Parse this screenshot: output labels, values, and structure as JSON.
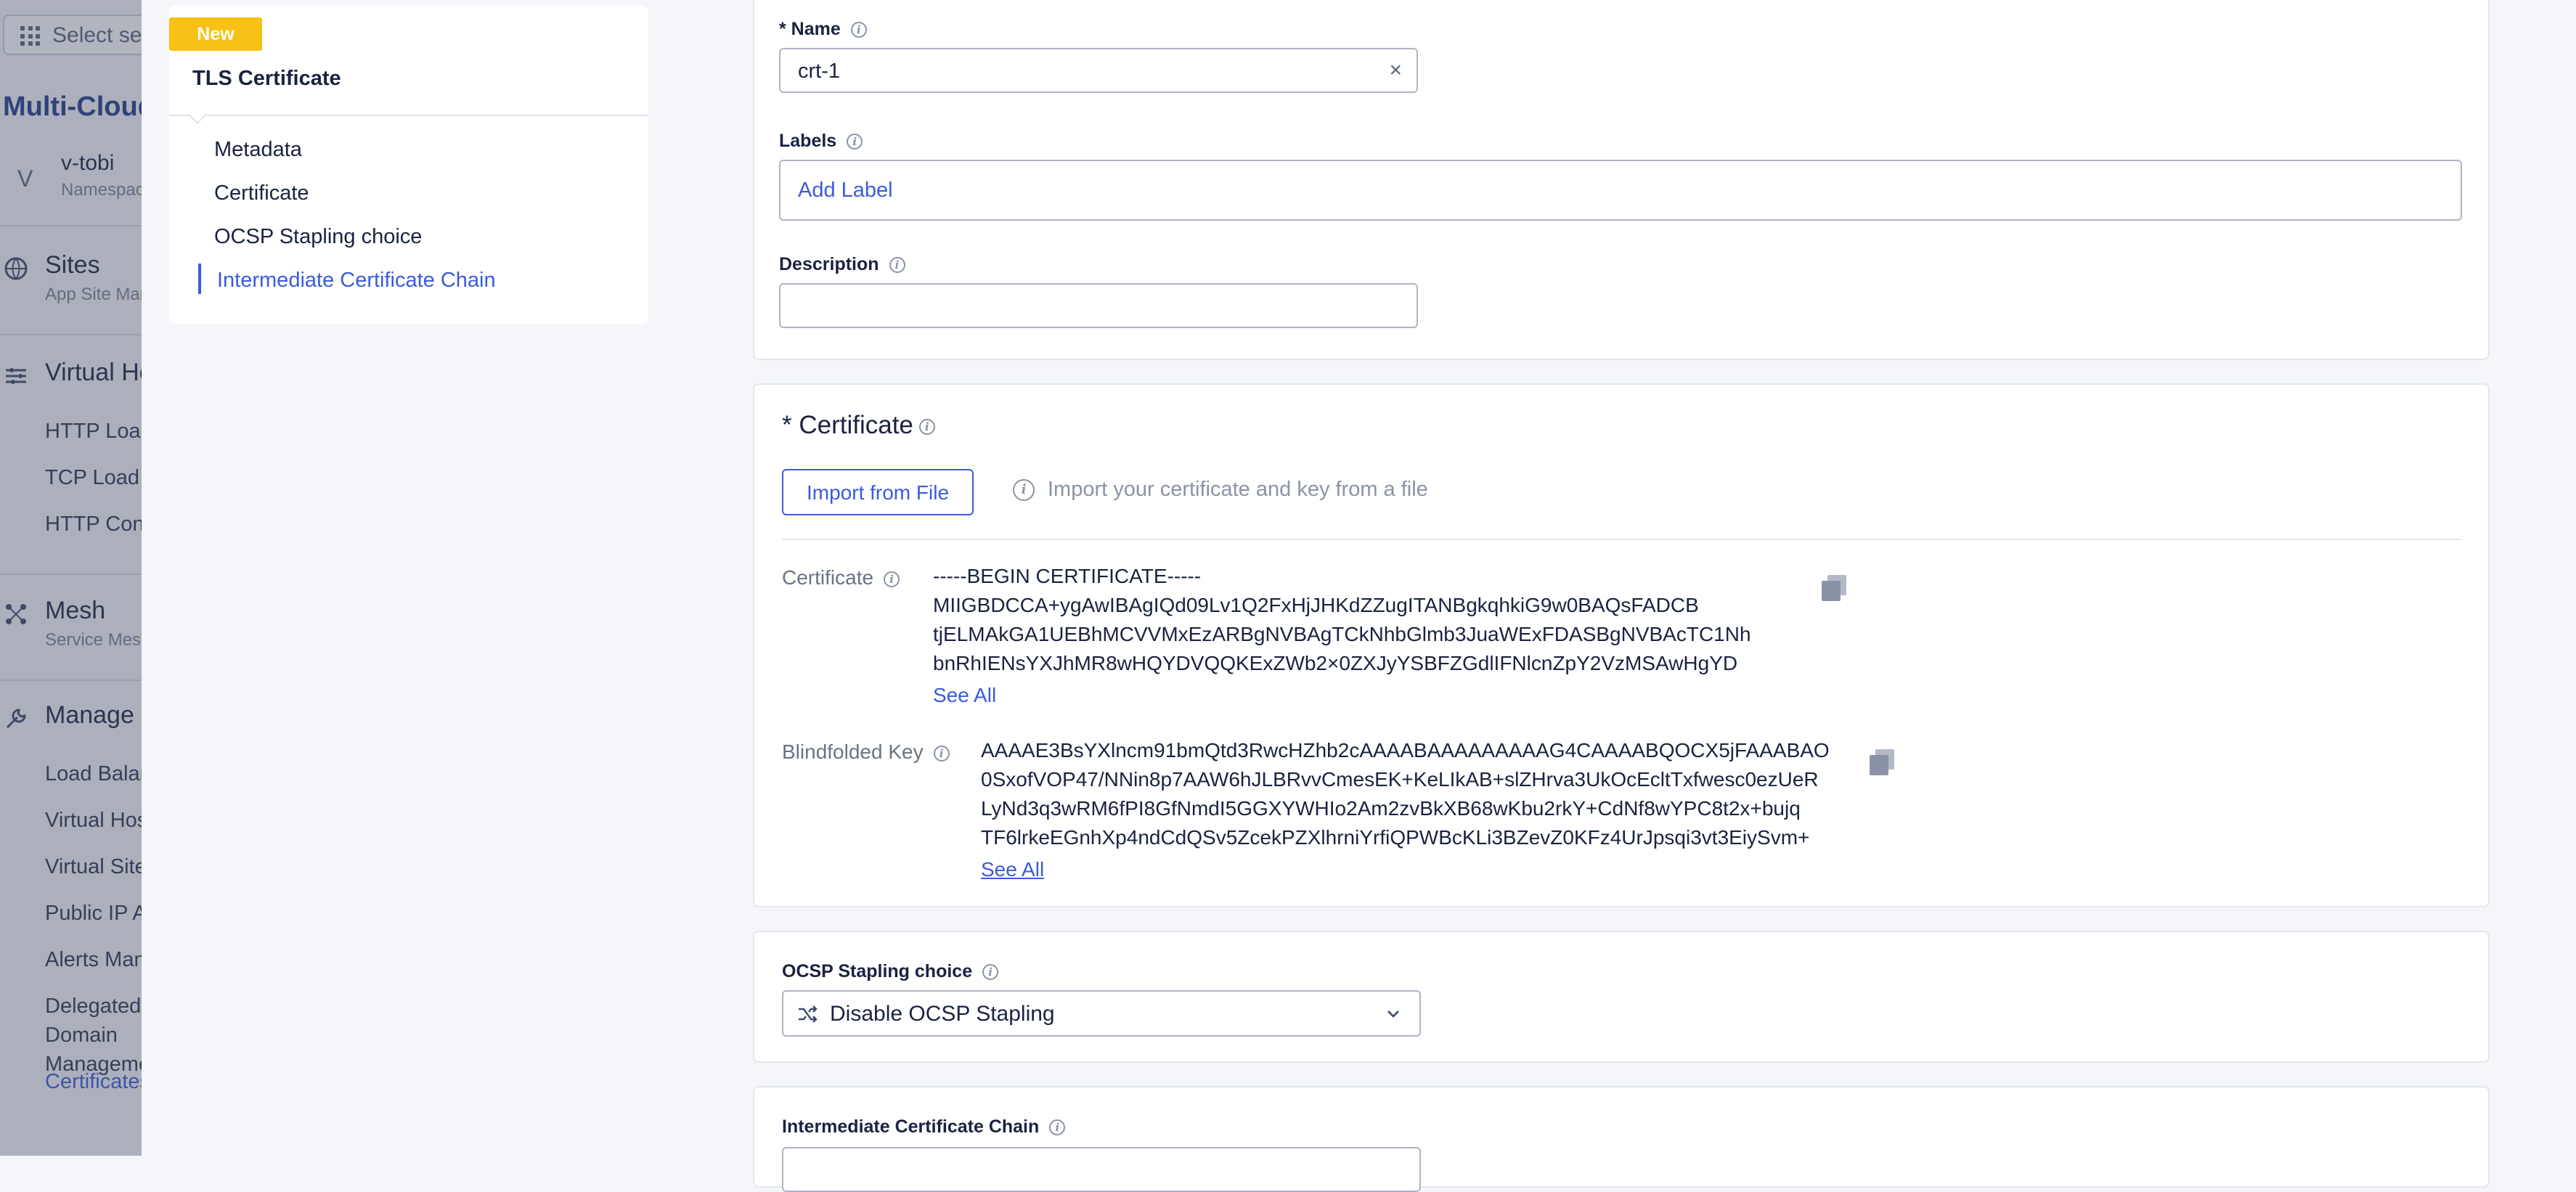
{
  "app_sidebar": {
    "select_service": "Select service",
    "product_title": "Multi-Cloud App Connect",
    "namespace": {
      "avatar": "V",
      "name": "v-tobi",
      "label": "Namespace"
    },
    "sections": [
      {
        "title": "Sites",
        "subtitle": "App Site Management"
      },
      {
        "title": "Virtual Hosts",
        "items": [
          "HTTP Load Balancers",
          "TCP Load Balancers",
          "HTTP Connect Proxies"
        ]
      },
      {
        "title": "Mesh",
        "subtitle": "Service Mesh"
      },
      {
        "title": "Manage",
        "items": [
          "Load Balancers",
          "Virtual Hosts",
          "Virtual Sites",
          "Public IP Addresses",
          "Alerts Management",
          "Delegated Domain Management",
          "Certificates"
        ]
      }
    ]
  },
  "toc": {
    "badge": "New",
    "title": "TLS Certificate",
    "items": [
      "Metadata",
      "Certificate",
      "OCSP Stapling choice",
      "Intermediate Certificate Chain"
    ],
    "active_index": 3
  },
  "metadata": {
    "name_label": "* Name",
    "name_value": "crt-1",
    "labels_label": "Labels",
    "labels_placeholder": "Add Label",
    "description_label": "Description",
    "description_value": ""
  },
  "certificate": {
    "title": "* Certificate",
    "import_button": "Import from File",
    "import_hint": "Import your certificate and key from a file",
    "certificate_label": "Certificate",
    "certificate_lines": [
      "-----BEGIN CERTIFICATE-----",
      "MIIGBDCCA+ygAwIBAgIQd09Lv1Q2FxHjJHKdZZugITANBgkqhkiG9w0BAQsFADCB",
      "tjELMAkGA1UEBhMCVVMxEzARBgNVBAgTCkNhbGlmb3JuaWExFDASBgNVBAcTC1Nh",
      "bnRhIENsYXJhMR8wHQYDVQQKExZWb2×0ZXJyYSBFZGdlIFNlcnZpY2VzMSAwHgYD"
    ],
    "see_all": "See All",
    "key_label": "Blindfolded Key",
    "key_lines": [
      "AAAAE3BsYXlncm91bmQtd3RwcHZhb2cAAAABAAAAAAAAAG4CAAAABQOCX5jFAAABAO",
      "0SxofVOP47/NNin8p7AAW6hJLBRvvCmesEK+KeLIkAB+slZHrva3UkOcEcltTxfwesc0ezUeR",
      "LyNd3q3wRM6fPI8GfNmdI5GGXYWHIo2Am2zvBkXB68wKbu2rkY+CdNf8wYPC8t2x+bujq",
      "TF6lrkeEGnhXp4ndCdQSv5ZcekPZXlhrniYrfiQPWBcKLi3BZevZ0KFz4UrJpsqi3vt3EiySvm+"
    ],
    "key_see_all": "See All"
  },
  "ocsp": {
    "label": "OCSP Stapling choice",
    "selected": "Disable OCSP Stapling"
  },
  "intermediate": {
    "label": "Intermediate Certificate Chain"
  },
  "icons": {
    "info": "i",
    "clear": "×"
  },
  "colors": {
    "accent": "#3b5bdb",
    "badge": "#f8c115",
    "text": "#1a2340",
    "muted": "#8a93a6"
  }
}
